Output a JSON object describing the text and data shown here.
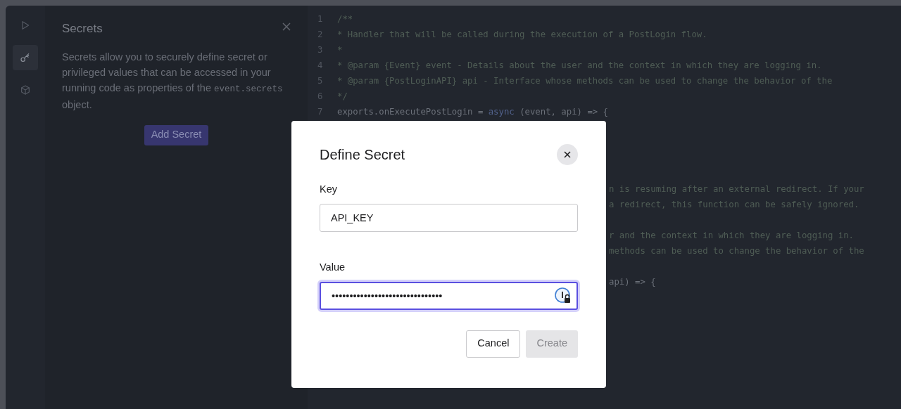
{
  "rail": [
    {
      "kind": "run",
      "selected": false
    },
    {
      "kind": "key",
      "selected": true
    },
    {
      "kind": "box",
      "selected": false
    }
  ],
  "sidebar": {
    "title": "Secrets",
    "description_before": "Secrets allow you to securely define secret or privileged values that can be accessed in your running code as properties of the",
    "description_code": "event.secrets",
    "description_after": "object.",
    "button": "Add Secret"
  },
  "editor": {
    "lines": [
      {
        "number": "1",
        "tokens": [
          {
            "kind": "comment",
            "text": "/**"
          }
        ]
      },
      {
        "number": "2",
        "tokens": [
          {
            "kind": "comment",
            "text": "* Handler that will be called during the execution of a PostLogin flow."
          }
        ]
      },
      {
        "number": "3",
        "tokens": [
          {
            "kind": "comment",
            "text": "*"
          }
        ]
      },
      {
        "number": "4",
        "tokens": [
          {
            "kind": "comment",
            "text": "* @param {Event} event - Details about the user and the context in which they are logging in."
          }
        ]
      },
      {
        "number": "5",
        "tokens": [
          {
            "kind": "comment",
            "text": "* @param {PostLoginAPI} api - Interface whose methods can be used to change the behavior of the"
          }
        ]
      },
      {
        "number": "6",
        "tokens": [
          {
            "kind": "comment",
            "text": "*/"
          }
        ]
      },
      {
        "number": "7",
        "tokens": [
          {
            "kind": "plain",
            "text": "exports.onExecutePostLogin = "
          },
          {
            "kind": "keyword",
            "text": "async"
          },
          {
            "kind": "plain",
            "text": " (event, api) => {"
          }
        ]
      }
    ],
    "covered_blocks": [
      [
        {
          "kind": "comment",
          "text": "n is resuming after an external redirect. If your"
        },
        {
          "kind": "comment",
          "text": "a redirect, this function can be safely ignored."
        }
      ],
      [
        {
          "kind": "comment",
          "text": "r and the context in which they are logging in."
        },
        {
          "kind": "comment",
          "text": "methods can be used to change the behavior of the"
        }
      ],
      [
        {
          "kind": "plain",
          "text": "api) => {"
        }
      ]
    ]
  },
  "dialog": {
    "title": "Define Secret",
    "fields": [
      {
        "label": "Key",
        "value": "API_KEY",
        "focused": false,
        "password_manager": false
      },
      {
        "label": "Value",
        "value": "•••••••••••••••••••••••••••••••",
        "focused": true,
        "password_manager": true
      }
    ],
    "buttons": [
      {
        "label": "Cancel",
        "kind": "secondary",
        "disabled": false
      },
      {
        "label": "Create",
        "kind": "primary",
        "disabled": true
      }
    ]
  }
}
